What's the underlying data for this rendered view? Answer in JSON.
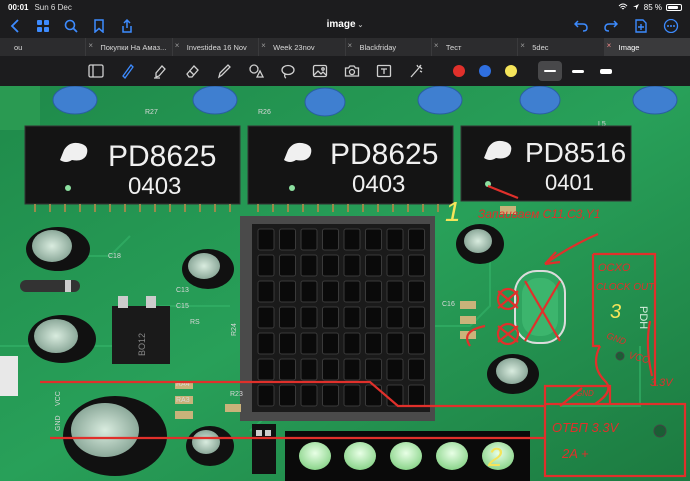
{
  "status_bar": {
    "time": "00:01",
    "date": "Sun 6 Dec",
    "battery": "85 %",
    "battery_level": 0.85
  },
  "nav": {
    "title": "image"
  },
  "tabs": [
    {
      "label": "ou"
    },
    {
      "label": "Покупки На Амаз..."
    },
    {
      "label": "Investidea 16 Nov"
    },
    {
      "label": "Week 23nov"
    },
    {
      "label": "Blackfriday"
    },
    {
      "label": "Тест"
    },
    {
      "label": "5dec"
    },
    {
      "label": "Image"
    }
  ],
  "active_tab": 7,
  "toolbar": {
    "colors": [
      "#e0302b",
      "#2f6fe0",
      "#f5e45a"
    ],
    "strokes": [
      "thin",
      "medium",
      "thick"
    ],
    "selected_stroke": 0
  },
  "photo": {
    "chips": [
      {
        "brand": "PD8625",
        "code": "0403"
      },
      {
        "brand": "PD8625",
        "code": "0403"
      },
      {
        "brand": "PD8516",
        "code": "0401"
      }
    ],
    "board_labels": {
      "rs": "RS",
      "c18": "C18",
      "c13": "C13",
      "c15": "C15",
      "c16": "C16",
      "r24": "R24",
      "r23": "R23",
      "r26": "R26",
      "r27": "R27",
      "gnd": "GND",
      "vcc": "VCC",
      "ra4": "RA4",
      "ra3": "RA3",
      "bo12": "BO12",
      "pdh": "PDH",
      "l5": "L5",
      "l1": "L1"
    },
    "annotations": {
      "step1": "1",
      "step1_note": "Запаиваем C11,C3,Y1",
      "step2": "2",
      "step3": "3",
      "ocxo": "OCXO",
      "clock_out": "CLOCK OUT",
      "gnd": "GND",
      "gnd2": "GND",
      "vcc": "VCC",
      "v33": "3.3V",
      "psu_line1": "ОТБП 3.3V",
      "psu_line2": "2A +"
    }
  }
}
